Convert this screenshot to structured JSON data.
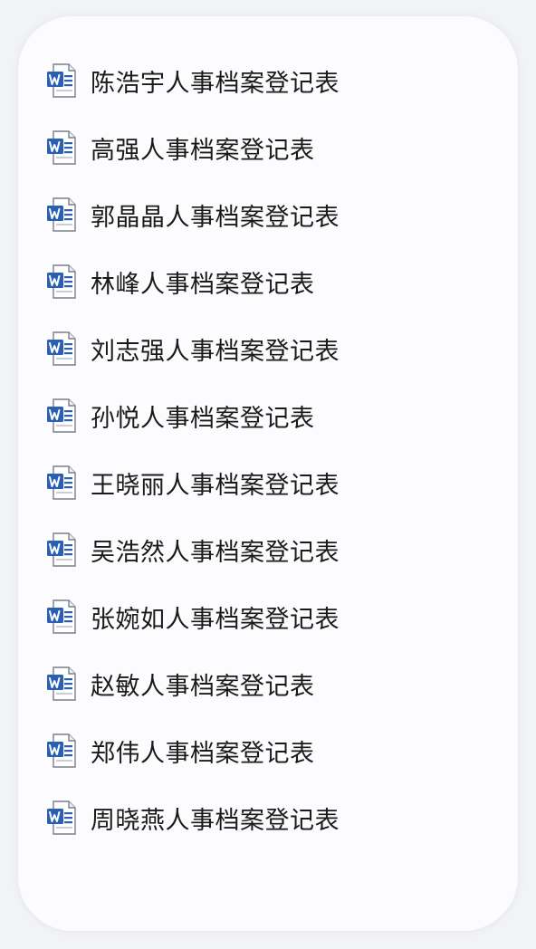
{
  "files": [
    {
      "name": "陈浩宇人事档案登记表",
      "icon": "word-doc-icon"
    },
    {
      "name": "高强人事档案登记表",
      "icon": "word-doc-icon"
    },
    {
      "name": "郭晶晶人事档案登记表",
      "icon": "word-doc-icon"
    },
    {
      "name": "林峰人事档案登记表",
      "icon": "word-doc-icon"
    },
    {
      "name": "刘志强人事档案登记表",
      "icon": "word-doc-icon"
    },
    {
      "name": "孙悦人事档案登记表",
      "icon": "word-doc-icon"
    },
    {
      "name": "王晓丽人事档案登记表",
      "icon": "word-doc-icon"
    },
    {
      "name": "吴浩然人事档案登记表",
      "icon": "word-doc-icon"
    },
    {
      "name": "张婉如人事档案登记表",
      "icon": "word-doc-icon"
    },
    {
      "name": "赵敏人事档案登记表",
      "icon": "word-doc-icon"
    },
    {
      "name": "郑伟人事档案登记表",
      "icon": "word-doc-icon"
    },
    {
      "name": "周晓燕人事档案登记表",
      "icon": "word-doc-icon"
    }
  ],
  "colors": {
    "page_background": "#f2f3f7",
    "panel_background": "#fcfcfe",
    "word_blue": "#2b5fb4",
    "text": "#1a1a1a"
  }
}
